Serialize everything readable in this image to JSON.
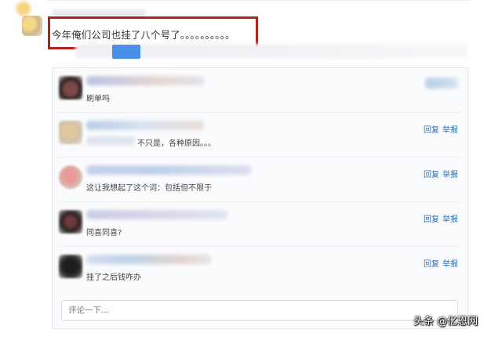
{
  "post": {
    "text": "今年俺们公司也挂了八个号了。。。。。。。。。。"
  },
  "comments": [
    {
      "text": "刷单吗",
      "actions": []
    },
    {
      "text": "不只是，各种原因。。。",
      "actions": [
        "回复",
        "举报"
      ]
    },
    {
      "text": "这让我想起了这个词：包括但不限于",
      "actions": [
        "回复",
        "举报"
      ]
    },
    {
      "text": "同喜同喜?",
      "actions": [
        "回复",
        "举报"
      ]
    },
    {
      "text": "挂了之后钱咋办",
      "actions": [
        "回复",
        "举报"
      ]
    }
  ],
  "comment_input": {
    "placeholder": "评论一下..."
  },
  "watermark": "头条 @亿恩网",
  "colors": {
    "highlight": "#b41f16",
    "link": "#2f6fb3",
    "button": "#4a8fe7"
  }
}
